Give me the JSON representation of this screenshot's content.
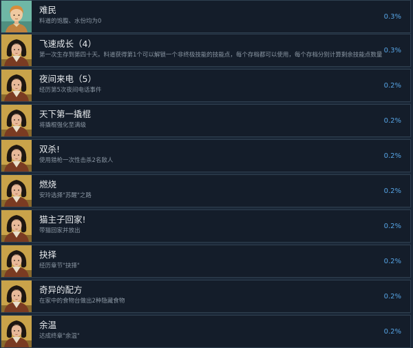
{
  "achievements": [
    {
      "icon": "boy-portrait-icon",
      "title": "难民",
      "description": "料道的饱腹、水份均为0",
      "percent": "0.3%"
    },
    {
      "icon": "girl-portrait-icon",
      "title": "飞速成长（4）",
      "description": "第一次生存到第四十天。料道获得第1个可以解锁一个非终极技能的技能点，每个存档都可以使用，每个存档分别计算剩余技能点数量",
      "percent": "0.3%"
    },
    {
      "icon": "girl-portrait-icon",
      "title": "夜间来电（5）",
      "description": "经历第5次夜间电话事件",
      "percent": "0.2%"
    },
    {
      "icon": "girl-portrait-icon",
      "title": "天下第一撬棍",
      "description": "将撬棍强化至满级",
      "percent": "0.2%"
    },
    {
      "icon": "girl-portrait-icon",
      "title": "双杀!",
      "description": "使用猎枪一次性击杀2名敌人",
      "percent": "0.2%"
    },
    {
      "icon": "girl-portrait-icon",
      "title": "燃烧",
      "description": "安玲选择\"苏醒\"之路",
      "percent": "0.2%"
    },
    {
      "icon": "girl-portrait-icon",
      "title": "猫主子回家!",
      "description": "带猫回家并放出",
      "percent": "0.2%"
    },
    {
      "icon": "girl-portrait-icon",
      "title": "抉择",
      "description": "经历章节\"抉择\"",
      "percent": "0.2%"
    },
    {
      "icon": "girl-portrait-icon",
      "title": "奇异的配方",
      "description": "在家中的食物台做出2种隐藏食物",
      "percent": "0.2%"
    },
    {
      "icon": "girl-portrait-icon",
      "title": "余温",
      "description": "达成终章\"余温\"",
      "percent": "0.2%"
    }
  ]
}
